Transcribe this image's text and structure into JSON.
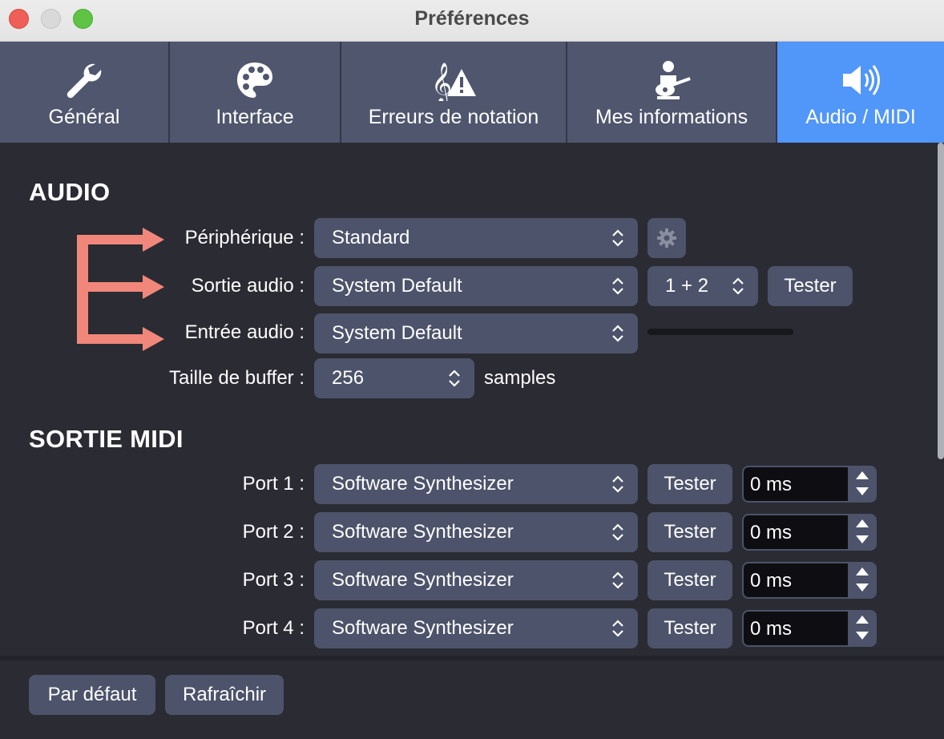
{
  "window": {
    "title": "Préférences"
  },
  "tabs": [
    {
      "label": "Général",
      "icon": "wrench-icon"
    },
    {
      "label": "Interface",
      "icon": "palette-icon"
    },
    {
      "label": "Erreurs de notation",
      "icon": "clef-warning-icon"
    },
    {
      "label": "Mes informations",
      "icon": "guitar-player-icon"
    },
    {
      "label": "Audio / MIDI",
      "icon": "speaker-icon",
      "active": true
    }
  ],
  "audio": {
    "title": "AUDIO",
    "device": {
      "label": "Périphérique :",
      "value": "Standard"
    },
    "output": {
      "label": "Sortie audio :",
      "value": "System Default",
      "channels": "1 + 2",
      "test": "Tester"
    },
    "input": {
      "label": "Entrée audio :",
      "value": "System Default"
    },
    "buffer": {
      "label": "Taille de buffer :",
      "value": "256",
      "unit": "samples"
    }
  },
  "midi": {
    "title": "SORTIE MIDI",
    "ports": [
      {
        "label": "Port 1 :",
        "value": "Software Synthesizer",
        "test": "Tester",
        "delay": "0 ms"
      },
      {
        "label": "Port 2 :",
        "value": "Software Synthesizer",
        "test": "Tester",
        "delay": "0 ms"
      },
      {
        "label": "Port 3 :",
        "value": "Software Synthesizer",
        "test": "Tester",
        "delay": "0 ms"
      },
      {
        "label": "Port 4 :",
        "value": "Software Synthesizer",
        "test": "Tester",
        "delay": "0 ms"
      }
    ]
  },
  "footer": {
    "default": "Par défaut",
    "refresh": "Rafraîchir"
  },
  "colors": {
    "accent": "#5196f9",
    "arrow": "#f0877a",
    "control": "#4c536a",
    "background": "#2b2b33"
  }
}
